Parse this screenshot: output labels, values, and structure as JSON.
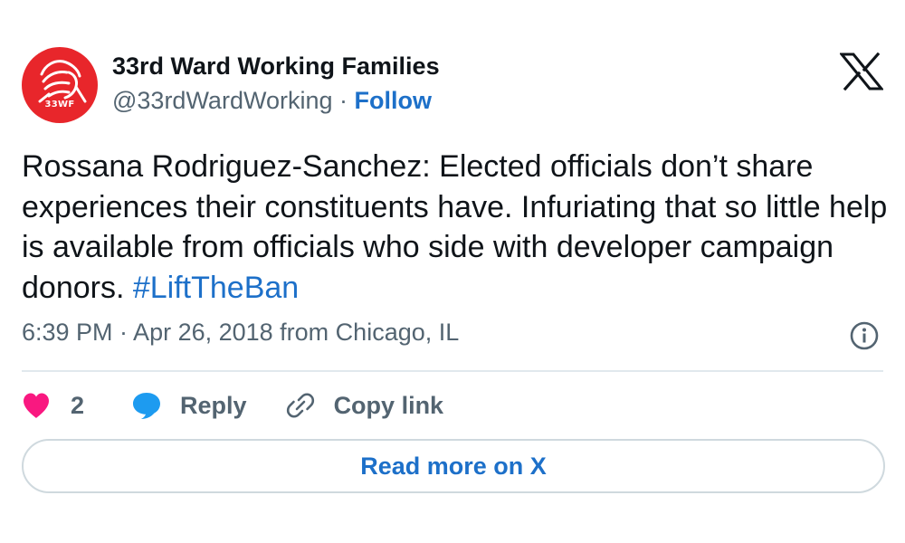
{
  "author": {
    "display_name": "33rd Ward Working Families",
    "handle": "@33rdWardWorking",
    "separator": "·",
    "follow_label": "Follow",
    "avatar_text": "33WF",
    "avatar_icon": "raised-fist-icon"
  },
  "tweet": {
    "text": "Rossana Rodriguez-Sanchez: Elected officials don’t share experiences their constituents have. Infuriating that so little help is available from officials who side with developer campaign donors. ",
    "hashtag": "#LiftTheBan",
    "timestamp": "6:39 PM · Apr 26, 2018 from Chicago, IL"
  },
  "actions": {
    "like_count": "2",
    "reply_label": "Reply",
    "copy_link_label": "Copy link"
  },
  "read_more_label": "Read more on X",
  "colors": {
    "accent": "#1d70c9",
    "like": "#f91880",
    "avatar_bg": "#e8262b",
    "secondary_text": "#536471",
    "primary_text": "#0f1419",
    "border": "#cfd9de"
  },
  "icons": {
    "logo": "x-logo-icon",
    "info": "info-icon",
    "like": "heart-icon",
    "reply": "speech-bubble-icon",
    "copy": "link-icon"
  }
}
